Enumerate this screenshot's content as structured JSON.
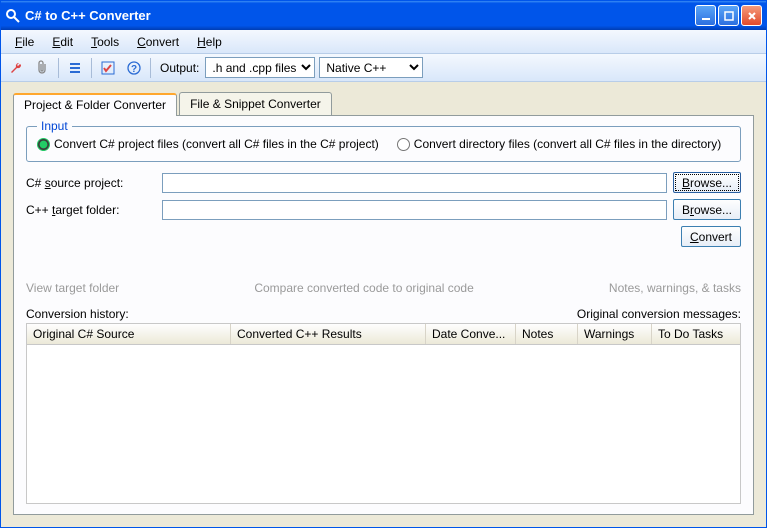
{
  "window": {
    "title": "C# to C++ Converter"
  },
  "menu": {
    "file": "File",
    "edit": "Edit",
    "tools": "Tools",
    "convert": "Convert",
    "help": "Help"
  },
  "toolbar": {
    "output_label": "Output:",
    "output_select": ".h and .cpp files",
    "target_select": "Native C++"
  },
  "tabs": {
    "project": "Project & Folder Converter",
    "snippet": "File & Snippet Converter"
  },
  "input_group": {
    "legend": "Input",
    "radio_project": "Convert C# project files (convert all C# files in the C# project)",
    "radio_directory": "Convert directory files (convert all C# files in the directory)"
  },
  "form": {
    "source_label": "C# source project:",
    "target_label": "C++ target folder:",
    "browse": "Browse...",
    "convert": "Convert"
  },
  "links": {
    "view_target": "View target folder",
    "compare": "Compare converted code to original code",
    "notes": "Notes, warnings, & tasks"
  },
  "history": {
    "label_left": "Conversion history:",
    "label_right": "Original conversion messages:",
    "cols": {
      "c1": "Original C# Source",
      "c2": "Converted C++ Results",
      "c3": "Date Conve...",
      "c4": "Notes",
      "c5": "Warnings",
      "c6": "To Do Tasks"
    }
  }
}
